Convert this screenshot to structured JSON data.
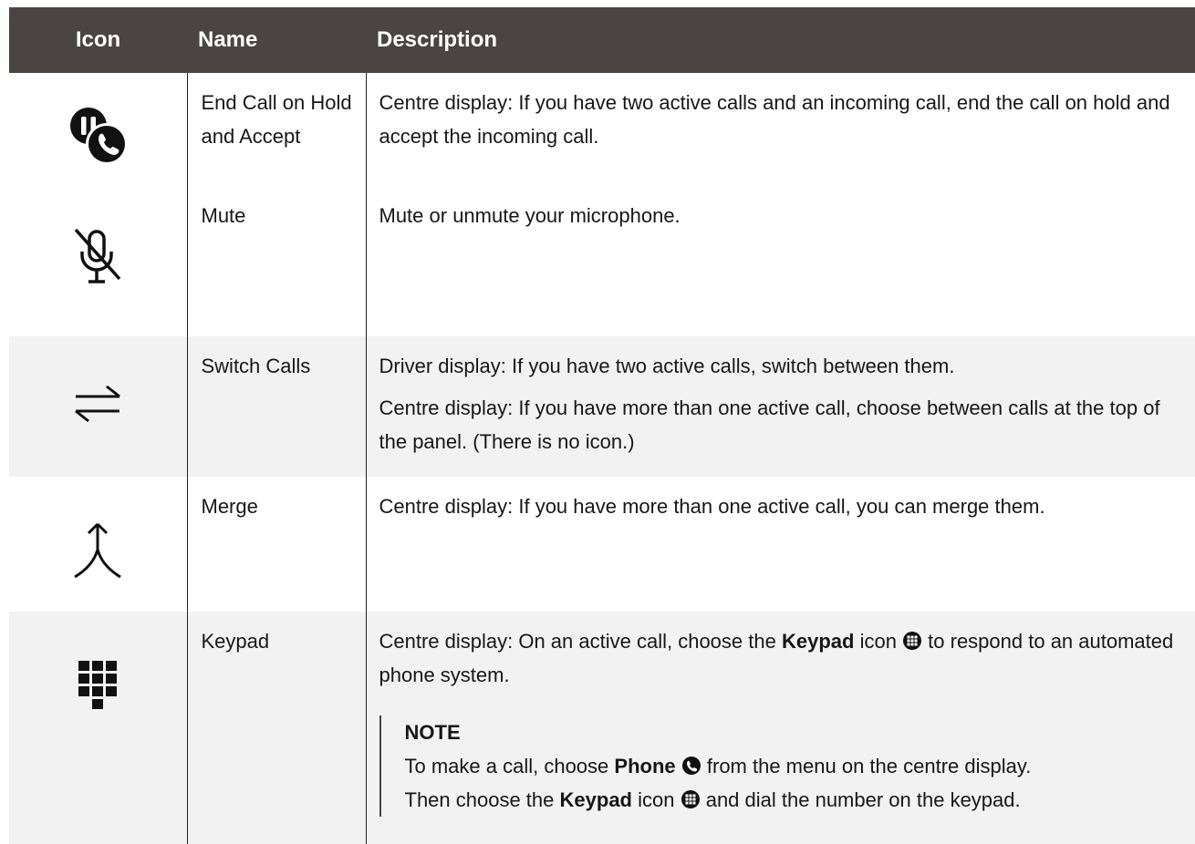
{
  "header": {
    "col_icon": "Icon",
    "col_name": "Name",
    "col_desc": "Description"
  },
  "rows": [
    {
      "icon": "end-hold-accept-icon",
      "name": "End Call on Hold and Accept",
      "desc": [
        "Centre display: If you have two active calls and an incoming call, end the call on hold and accept the incoming call."
      ]
    },
    {
      "icon": "mute-icon",
      "name": "Mute",
      "desc": [
        "Mute or unmute your microphone."
      ]
    },
    {
      "icon": "switch-calls-icon",
      "name": "Switch Calls",
      "desc": [
        "Driver display: If you have two active calls, switch between them.",
        "Centre display: If you have more than one active call, choose between calls at the top of the panel. (There is no icon.)"
      ]
    },
    {
      "icon": "merge-icon",
      "name": "Merge",
      "desc": [
        "Centre display: If you have more than one active call, you can merge them."
      ]
    },
    {
      "icon": "keypad-icon",
      "name": "Keypad",
      "desc_parts": {
        "a": "Centre display: On an active call, choose the ",
        "b": "Keypad",
        "c": " icon ",
        "d": " to respond to an automated phone system."
      },
      "note": {
        "title": "NOTE",
        "l1a": "To make a call, choose ",
        "l1b": "Phone",
        "l1c": " from the menu on the centre display.",
        "l2a": "Then choose the ",
        "l2b": "Keypad",
        "l2c": " icon ",
        "l2d": " and dial the number on the keypad."
      }
    }
  ],
  "colors": {
    "header_bg": "#4a4542",
    "alt_row_bg": "#f2f2f2",
    "text": "#171717"
  }
}
